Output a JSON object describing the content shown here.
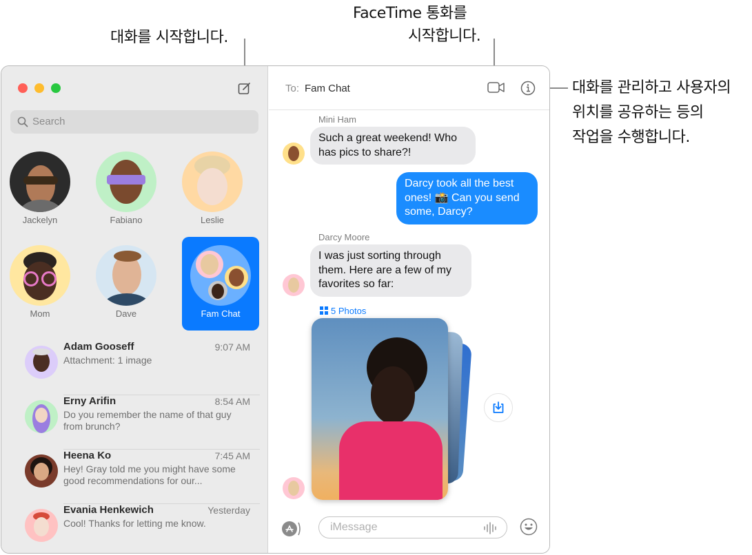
{
  "callouts": {
    "compose": "대화를 시작합니다.",
    "facetime_line1": "FaceTime 통화를",
    "facetime_line2": "시작합니다.",
    "info_line1": "대화를 관리하고 사용자의",
    "info_line2": "위치를 공유하는 등의",
    "info_line3": "작업을 수행합니다."
  },
  "sidebar": {
    "search_placeholder": "Search",
    "pinned": [
      {
        "name": "Jackelyn",
        "bg": "#2b2b2b"
      },
      {
        "name": "Fabiano",
        "bg": "#bff0c6"
      },
      {
        "name": "Leslie",
        "bg": "#ffd9a3"
      },
      {
        "name": "Mom",
        "bg": "#ffe7a0"
      },
      {
        "name": "Dave",
        "bg": "#d6e6f2"
      },
      {
        "name": "Fam Chat",
        "bg": "#6bb0ff",
        "selected": true
      }
    ],
    "conversations": [
      {
        "name": "Adam Gooseff",
        "time": "9:07 AM",
        "preview": "Attachment: 1 image",
        "bg": "#dccdfa"
      },
      {
        "name": "Erny Arifin",
        "time": "8:54 AM",
        "preview": "Do you remember the name of that guy from brunch?",
        "bg": "#bff0c6"
      },
      {
        "name": "Heena Ko",
        "time": "7:45 AM",
        "preview": "Hey! Gray told me you might have some good recommendations for our...",
        "bg": "#7a3b2b"
      },
      {
        "name": "Evania Henkewich",
        "time": "Yesterday",
        "preview": "Cool! Thanks for letting me know.",
        "bg": "#ffc2c2"
      }
    ]
  },
  "chat": {
    "to_label": "To:",
    "to_value": "Fam Chat",
    "messages": [
      {
        "sender": "Mini Ham",
        "text": "Such a great weekend! Who has pics to share?!",
        "direction": "incoming"
      },
      {
        "text": "Darcy took all the best ones! 📸 Can you send some, Darcy?",
        "direction": "outgoing"
      },
      {
        "sender": "Darcy Moore",
        "text": "I was just sorting through them. Here are a few of my favorites so far:",
        "direction": "incoming"
      }
    ],
    "photos_label": "5 Photos",
    "input_placeholder": "iMessage"
  },
  "colors": {
    "accent": "#0a7aff",
    "outgoing_bubble": "#1a8cff",
    "incoming_bubble": "#e9e9eb",
    "close": "#ff5f57",
    "minimize": "#febc2e",
    "zoom": "#28c840"
  }
}
